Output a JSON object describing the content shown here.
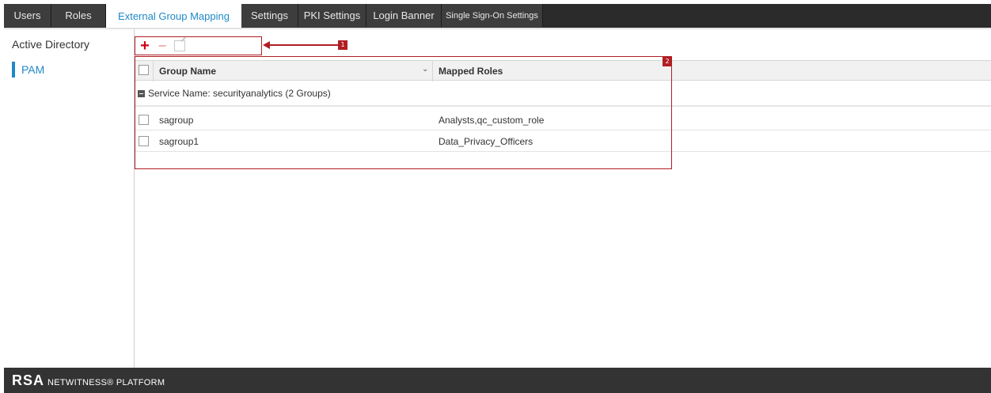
{
  "tabs": [
    {
      "label": "Users",
      "active": false
    },
    {
      "label": "Roles",
      "active": false
    },
    {
      "label": "External Group Mapping",
      "active": true
    },
    {
      "label": "Settings",
      "active": false
    },
    {
      "label": "PKI Settings",
      "active": false
    },
    {
      "label": "Login Banner",
      "active": false
    },
    {
      "label": "Single Sign-On Settings",
      "active": false
    }
  ],
  "sidebar": {
    "items": [
      {
        "label": "Active Directory",
        "active": false
      },
      {
        "label": "PAM",
        "active": true
      }
    ]
  },
  "toolbar": {
    "add_icon": "plus-icon",
    "remove_icon": "minus-icon",
    "edit_icon": "edit-icon"
  },
  "callouts": [
    "1",
    "2"
  ],
  "grid": {
    "columns": [
      "Group Name",
      "Mapped Roles"
    ],
    "group_label": "Service Name: securityanalytics (2 Groups)",
    "rows": [
      {
        "group_name": "sagroup",
        "mapped_roles": "Analysts,qc_custom_role"
      },
      {
        "group_name": "sagroup1",
        "mapped_roles": "Data_Privacy_Officers"
      }
    ]
  },
  "footer": {
    "brand_rsa": "RSA",
    "brand_rest": "NETWITNESS® PLATFORM"
  },
  "colors": {
    "accent": "#1e88c8",
    "callout": "#b01e23",
    "add": "#d0021b",
    "dark": "#333333"
  }
}
